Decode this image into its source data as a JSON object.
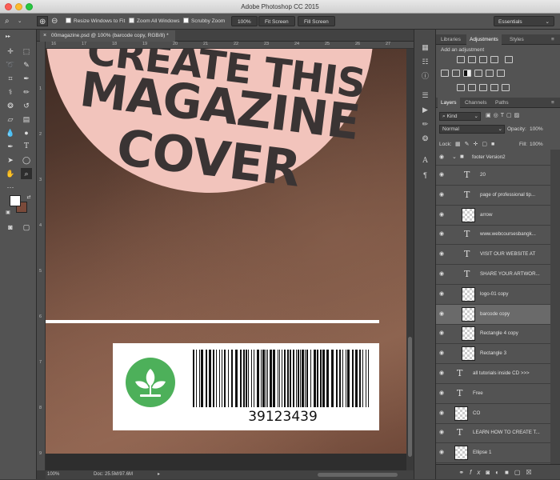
{
  "app": {
    "title": "Adobe Photoshop CC 2015"
  },
  "options_bar": {
    "resize_windows": "Resize Windows to Fit",
    "zoom_all": "Zoom All Windows",
    "scrubby_zoom": "Scrubby Zoom",
    "zoom_100": "100%",
    "fit_screen": "Fit Screen",
    "fill_screen": "Fill Screen",
    "workspace": "Essentials"
  },
  "document": {
    "tab_title": "00magazine.psd @ 100% (barcode copy, RGB/8) *",
    "headline": [
      "CREATE THIS",
      "MAGAZINE",
      "COVER"
    ],
    "barcode_number": "39123439",
    "ruler_top": [
      "16",
      "17",
      "18",
      "19",
      "20",
      "21",
      "22",
      "23",
      "24",
      "25",
      "26",
      "27"
    ],
    "ruler_left": [
      "1",
      "2",
      "3",
      "4",
      "5",
      "6",
      "7",
      "8",
      "9"
    ]
  },
  "status": {
    "zoom": "100%",
    "doc_size": "Doc: 25.5M/97.6M"
  },
  "adjustments_panel": {
    "tabs": [
      "Libraries",
      "Adjustments",
      "Styles"
    ],
    "active_tab": "Adjustments",
    "hint": "Add an adjustment"
  },
  "layers_panel": {
    "tabs": [
      "Layers",
      "Channels",
      "Paths"
    ],
    "active_tab": "Layers",
    "filter": "Kind",
    "blend_mode": "Normal",
    "opacity_label": "Opacity:",
    "opacity": "100%",
    "lock_label": "Lock:",
    "fill_label": "Fill:",
    "fill": "100%",
    "group": "footer Version2",
    "layers": [
      {
        "name": "20",
        "kind": "text",
        "indent": true
      },
      {
        "name": "page of professional tip...",
        "kind": "text",
        "indent": true
      },
      {
        "name": "arrow",
        "kind": "image",
        "indent": true
      },
      {
        "name": "www.webcoursesbangk...",
        "kind": "text",
        "indent": true
      },
      {
        "name": "VISIT OUR WEBSITE AT",
        "kind": "text",
        "indent": true
      },
      {
        "name": "SHARE YOUR ARTWOR...",
        "kind": "text",
        "indent": true
      },
      {
        "name": "logo-01 copy",
        "kind": "image",
        "indent": true
      },
      {
        "name": "barcode copy",
        "kind": "image",
        "indent": true,
        "selected": true
      },
      {
        "name": "Rectangle 4 copy",
        "kind": "image",
        "indent": true
      },
      {
        "name": "Rectangle 3",
        "kind": "image",
        "indent": true
      },
      {
        "name": "all tutorials  inside CD >>>",
        "kind": "text",
        "indent": false
      },
      {
        "name": "Free",
        "kind": "text",
        "indent": false
      },
      {
        "name": "CO",
        "kind": "image",
        "indent": false
      },
      {
        "name": "LEARN HOW TO CREATE T...",
        "kind": "text",
        "indent": false
      },
      {
        "name": "Ellipse 1",
        "kind": "image",
        "indent": false
      }
    ]
  },
  "colors": {
    "accent_green": "#4db05a",
    "circle_pink": "#f2c4bc",
    "headline": "#3a3434",
    "background_color_swatch": "#7a4a3a"
  }
}
